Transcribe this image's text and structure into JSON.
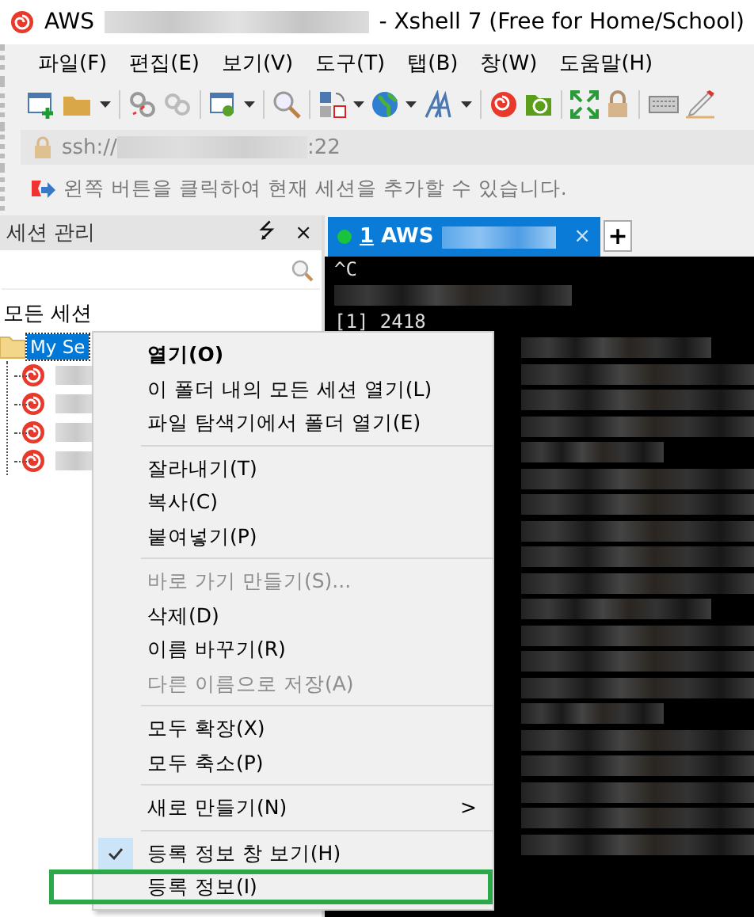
{
  "window": {
    "title_prefix": "AWS",
    "title_suffix": "- Xshell 7 (Free for Home/School)"
  },
  "menu": [
    "파일(F)",
    "편집(E)",
    "보기(V)",
    "도구(T)",
    "탭(B)",
    "창(W)",
    "도움말(H)"
  ],
  "address": {
    "scheme": "ssh://",
    "port": ":22"
  },
  "hint": "왼쪽 버튼을 클릭하여 현재 세션을 추가할 수 있습니다.",
  "session_panel": {
    "title": "세션 관리",
    "pin": "⭍",
    "close": "×",
    "tree": {
      "label": "모든 세션",
      "children": [
        {
          "label": "My Se",
          "selected": true,
          "children": [
            {
              "kind": "session"
            },
            {
              "kind": "session"
            },
            {
              "kind": "session"
            },
            {
              "kind": "session"
            }
          ]
        }
      ]
    }
  },
  "tabs": [
    {
      "number": "1",
      "label": "AWS",
      "connected": true,
      "selected": true,
      "close": "×"
    }
  ],
  "new_tab": "+",
  "terminal": {
    "lines": [
      {
        "kind": "text",
        "text": "^C"
      },
      {
        "kind": "redacted"
      },
      {
        "kind": "text",
        "text": "[1] 2418"
      },
      {
        "kind": "redacted"
      },
      {
        "kind": "redacted"
      },
      {
        "kind": "redacted"
      },
      {
        "kind": "redacted"
      },
      {
        "kind": "redacted"
      },
      {
        "kind": "redacted"
      },
      {
        "kind": "redacted"
      },
      {
        "kind": "redacted"
      },
      {
        "kind": "redacted"
      },
      {
        "kind": "redacted"
      },
      {
        "kind": "redacted"
      },
      {
        "kind": "redacted"
      },
      {
        "kind": "redacted"
      },
      {
        "kind": "redacted"
      },
      {
        "kind": "redacted"
      },
      {
        "kind": "redacted"
      },
      {
        "kind": "redacted"
      },
      {
        "kind": "redacted"
      },
      {
        "kind": "redacted"
      },
      {
        "kind": "redacted"
      }
    ]
  },
  "context_menu": [
    {
      "kind": "item",
      "label": "열기(O)",
      "bold": true,
      "disabled": false,
      "checked": false,
      "outlined": false
    },
    {
      "kind": "item",
      "label": "이 폴더 내의 모든 세션 열기(L)",
      "bold": false,
      "disabled": false,
      "checked": false,
      "outlined": false
    },
    {
      "kind": "item",
      "label": "파일 탐색기에서 폴더 열기(E)",
      "bold": false,
      "disabled": false,
      "checked": false,
      "outlined": false
    },
    {
      "kind": "separator"
    },
    {
      "kind": "item",
      "label": "잘라내기(T)",
      "bold": false,
      "disabled": false,
      "checked": false,
      "outlined": false
    },
    {
      "kind": "item",
      "label": "복사(C)",
      "bold": false,
      "disabled": false,
      "checked": false,
      "outlined": false
    },
    {
      "kind": "item",
      "label": "붙여넣기(P)",
      "bold": false,
      "disabled": false,
      "checked": false,
      "outlined": false
    },
    {
      "kind": "separator"
    },
    {
      "kind": "item",
      "label": "바로 가기 만들기(S)...",
      "bold": false,
      "disabled": true,
      "checked": false,
      "outlined": false
    },
    {
      "kind": "item",
      "label": "삭제(D)",
      "bold": false,
      "disabled": false,
      "checked": false,
      "outlined": false
    },
    {
      "kind": "item",
      "label": "이름 바꾸기(R)",
      "bold": false,
      "disabled": false,
      "checked": false,
      "outlined": false
    },
    {
      "kind": "item",
      "label": "다른 이름으로 저장(A)",
      "bold": false,
      "disabled": true,
      "checked": false,
      "outlined": false
    },
    {
      "kind": "separator"
    },
    {
      "kind": "item",
      "label": "모두 확장(X)",
      "bold": false,
      "disabled": false,
      "checked": false,
      "outlined": false
    },
    {
      "kind": "item",
      "label": "모두 축소(P)",
      "bold": false,
      "disabled": false,
      "checked": false,
      "outlined": false
    },
    {
      "kind": "separator"
    },
    {
      "kind": "submenu",
      "label": "새로 만들기(N)",
      "arrow": ">",
      "bold": false,
      "disabled": false,
      "checked": false,
      "outlined": false
    },
    {
      "kind": "separator"
    },
    {
      "kind": "item",
      "label": "등록 정보 창 보기(H)",
      "bold": false,
      "disabled": false,
      "checked": true,
      "outlined": false
    },
    {
      "kind": "item",
      "label": "등록 정보(I)",
      "bold": false,
      "disabled": false,
      "checked": false,
      "outlined": true
    }
  ]
}
